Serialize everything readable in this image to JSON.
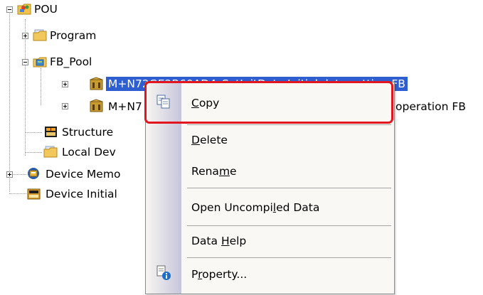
{
  "tree": {
    "root": {
      "label": "POU",
      "icon": "pou-folder-icon"
    },
    "program": {
      "label": "Program",
      "icon": "folder-icon"
    },
    "fb_pool": {
      "label": "FB_Pool",
      "icon": "fb-folder-icon"
    },
    "fb1": {
      "label": "M+N72GE2B60AD4_SetInitData Initial data setting FB",
      "icon": "fb-block-icon",
      "selected": true
    },
    "fb2": {
      "label": "M+N7",
      "label_tail": "operation FB",
      "icon": "fb-block-icon"
    },
    "structured": {
      "label": "Structure",
      "icon": "structured-data-icon"
    },
    "local_device": {
      "label": "Local Dev",
      "icon": "folder-icon"
    },
    "device_memory": {
      "label": "Device Memo",
      "icon": "device-memory-icon"
    },
    "device_initial": {
      "label": "Device Initial",
      "icon": "device-initial-icon"
    }
  },
  "context_menu": {
    "items": [
      {
        "label": "Copy",
        "mnemonic": "C",
        "icon": "copy-icon"
      },
      {
        "label": "Delete",
        "mnemonic": "D"
      },
      {
        "label": "Rename",
        "mnemonic": "m"
      },
      {
        "label": "Open Uncompiled Data",
        "mnemonic": "l"
      },
      {
        "label": "Data Help",
        "mnemonic": "H"
      },
      {
        "label": "Property...",
        "mnemonic": "r",
        "icon": "property-icon"
      }
    ]
  },
  "colors": {
    "selection": "#2f5ed0",
    "highlight_border": "#e1161f",
    "menu_background": "#f9f8f4"
  }
}
